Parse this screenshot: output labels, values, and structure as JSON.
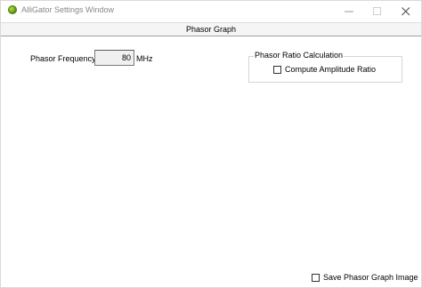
{
  "window": {
    "title": "AlliGator Settings Window"
  },
  "header": {
    "title": "Phasor Graph"
  },
  "phasor_frequency": {
    "label": "Phasor Frequency",
    "value": "80",
    "unit": "MHz"
  },
  "ratio_group": {
    "legend": "Phasor Ratio Calculation",
    "compute_amplitude_ratio": {
      "label": "Compute Amplitude Ratio",
      "checked": false
    }
  },
  "save_image": {
    "label": "Save Phasor Graph Image",
    "checked": false
  },
  "colors": {
    "app_icon": "#6aa316",
    "title_text": "#888888"
  },
  "icons": {
    "app": "alligator-app-icon",
    "minimize": "minimize-icon",
    "maximize": "maximize-icon",
    "close": "close-icon"
  }
}
